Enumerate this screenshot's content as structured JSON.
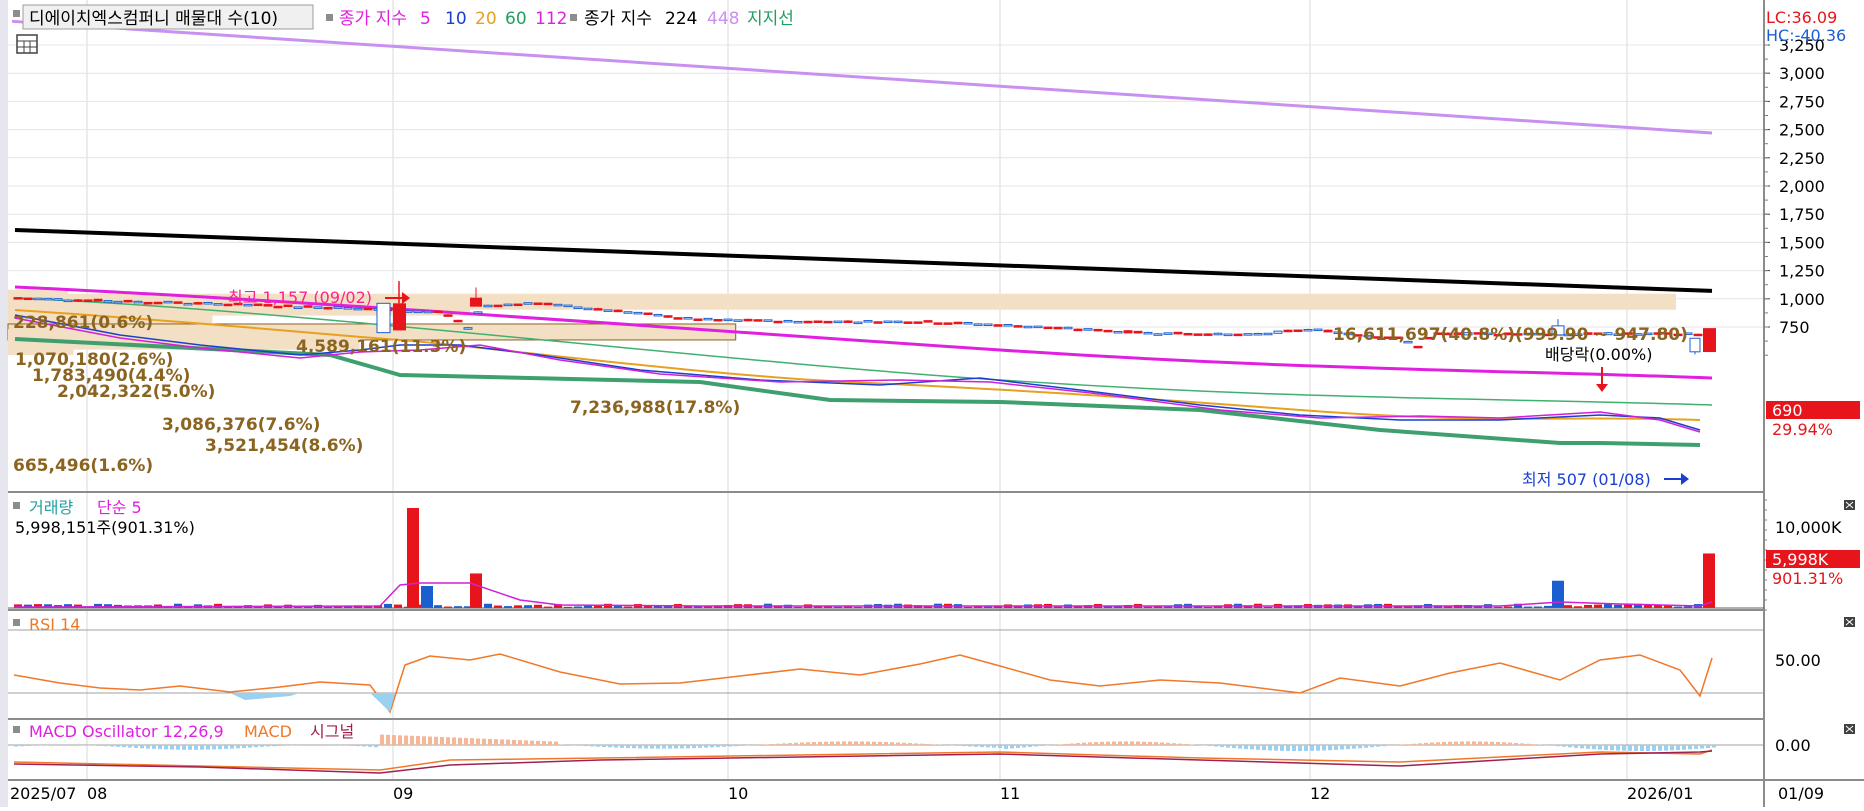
{
  "colors": {
    "up": "#e8141c",
    "down": "#1a5fd0",
    "ma5": "#d020d8",
    "ma10": "#1a3fd0",
    "ma20": "#e8a020",
    "ma60": "#20a060",
    "ma112": "#e020e0",
    "ma224": "#000000",
    "ma448": "#c890f0",
    "support": "#3f9f6f",
    "profile": "#f3dfc4",
    "profile_text": "#8a6420",
    "rsi": "#f07828",
    "macd_osc_pos": "#f4b898",
    "macd_osc_neg": "#9ad0f0",
    "macd": "#f07828",
    "signal": "#a02050"
  },
  "price_panel": {
    "legend": {
      "title": "디에이치엑스컴퍼니 매물대 수(10)",
      "close_index_label": "종가 지수",
      "ma_periods": [
        "5",
        "10",
        "20",
        "60",
        "112"
      ],
      "close_index_label2": "종가 지수",
      "ma_long": [
        "224",
        "448"
      ],
      "support_label": "지지선"
    },
    "lc": "LC:36.09",
    "hc": "HC:-40.36",
    "last_price": "690",
    "last_change": "29.94%",
    "high_annot": "최고 1,157 (09/02)",
    "low_annot": "최저 507 (01/08)",
    "dividend_annot": "배당락(0.00%)",
    "volume_profile": [
      {
        "label": "16,611,697(40.8%)(999.90 ~ 947.80)",
        "price": 974,
        "pct": 40.8
      },
      {
        "label": "4,589,161(11.3%)",
        "price": 922,
        "pct": 11.3
      },
      {
        "label": "228,861(0.6%)",
        "price": 1010,
        "pct": 0.6
      },
      {
        "label": "1,070,180(2.6%)",
        "price": 900,
        "pct": 2.6
      },
      {
        "label": "1,783,490(4.4%)",
        "price": 858,
        "pct": 4.4
      },
      {
        "label": "2,042,322(5.0%)",
        "price": 800,
        "pct": 5.0
      },
      {
        "label": "7,236,988(17.8%)",
        "price": 706,
        "pct": 17.8
      },
      {
        "label": "3,086,376(7.6%)",
        "price": 660,
        "pct": 7.6
      },
      {
        "label": "3,521,454(8.6%)",
        "price": 620,
        "pct": 8.6
      },
      {
        "label": "665,496(1.6%)",
        "price": 573,
        "pct": 1.6
      }
    ],
    "y_ticks": [
      "3,250",
      "3,000",
      "2,750",
      "2,500",
      "2,250",
      "2,000",
      "1,750",
      "1,500",
      "1,250",
      "1,000",
      "750"
    ]
  },
  "volume_panel": {
    "legend_label": "거래량",
    "ma_label": "단순 5",
    "current_value": "5,998,151주(901.31%)",
    "tick_label": "10,000K",
    "last_value": "5,998K",
    "last_change": "901.31%"
  },
  "rsi_panel": {
    "legend_label": "RSI 14",
    "tick_label": "50.00"
  },
  "macd_panel": {
    "osc_label": "MACD Oscillator 12,26,9",
    "macd_label": "MACD",
    "signal_label": "시그널",
    "tick_label": "0.00"
  },
  "x_axis": {
    "labels": [
      "2025/07",
      "08",
      "09",
      "10",
      "11",
      "12",
      "2026/01"
    ],
    "right_label": "01/09"
  },
  "chart_data": {
    "type": "candlestick",
    "title": "디에이치엑스컴퍼니",
    "x_range": [
      "2025-07-01",
      "2026-01-09"
    ],
    "y_range": [
      500,
      3300
    ],
    "grid": true,
    "legend_placement": "top-left",
    "ma224_start_end": [
      1610,
      1070
    ],
    "ma448_start_end": [
      3460,
      2470
    ],
    "price_close_path": [
      {
        "date": "2025-07-01",
        "close": 1010
      },
      {
        "date": "2025-07-15",
        "close": 980
      },
      {
        "date": "2025-08-01",
        "close": 950
      },
      {
        "date": "2025-08-15",
        "close": 920
      },
      {
        "date": "2025-08-28",
        "close": 880
      },
      {
        "date": "2025-09-01",
        "close": 720
      },
      {
        "date": "2025-09-02",
        "close": 940
      },
      {
        "date": "2025-09-10",
        "close": 960
      },
      {
        "date": "2025-09-20",
        "close": 900
      },
      {
        "date": "2025-10-01",
        "close": 820
      },
      {
        "date": "2025-10-15",
        "close": 800
      },
      {
        "date": "2025-11-01",
        "close": 800
      },
      {
        "date": "2025-11-15",
        "close": 760
      },
      {
        "date": "2025-12-01",
        "close": 700
      },
      {
        "date": "2025-12-15",
        "close": 680
      },
      {
        "date": "2025-12-24",
        "close": 730
      },
      {
        "date": "2026-01-05",
        "close": 650
      },
      {
        "date": "2026-01-08",
        "close": 560
      },
      {
        "date": "2026-01-09",
        "close": 690
      }
    ],
    "volume_spikes": [
      {
        "date": "2025-09-02",
        "volume_k": 11000
      },
      {
        "date": "2025-09-10",
        "volume_k": 3800
      },
      {
        "date": "2025-12-22",
        "volume_k": 3000
      },
      {
        "date": "2026-01-09",
        "volume_k": 5998
      }
    ],
    "rsi_last": 55,
    "macd_osc_last": 0
  }
}
